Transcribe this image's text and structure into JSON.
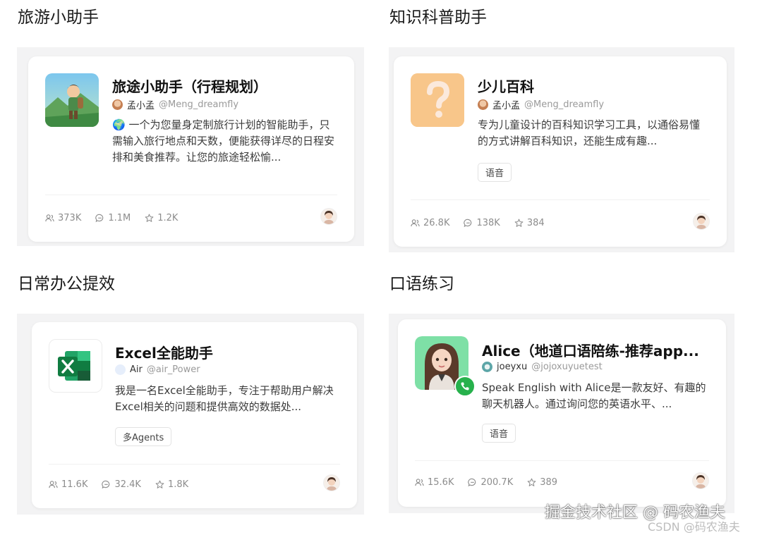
{
  "sections": [
    {
      "heading": "旅游小助手",
      "card": {
        "title": "旅途小助手（行程规划）",
        "author": "孟小孟",
        "handle": "@Meng_dreamfly",
        "description": "🌍 一个为您量身定制旅行计划的智能助手，只需输入旅行地点和天数，便能获得详尽的日程安排和美食推荐。让您的旅途轻松愉...",
        "tag": "",
        "users": "373K",
        "chats": "1.1M",
        "stars": "1.2K"
      }
    },
    {
      "heading": "知识科普助手",
      "card": {
        "title": "少儿百科",
        "author": "孟小孟",
        "handle": "@Meng_dreamfly",
        "description": "专为儿童设计的百科知识学习工具，以通俗易懂的方式讲解百科知识，还能生成有趣...",
        "tag": "语音",
        "users": "26.8K",
        "chats": "138K",
        "stars": "384"
      }
    },
    {
      "heading": "日常办公提效",
      "card": {
        "title": "Excel全能助手",
        "author": "Air",
        "handle": "@air_Power",
        "description": "我是一名Excel全能助手，专注于帮助用户解决Excel相关的问题和提供高效的数据处...",
        "tag": "多Agents",
        "users": "11.6K",
        "chats": "32.4K",
        "stars": "1.8K"
      }
    },
    {
      "heading": "口语练习",
      "card": {
        "title": "Alice（地道口语陪练-推荐app...",
        "author": "joeyxu",
        "handle": "@jojoxuyuetest",
        "description": "Speak English with Alice是一款友好、有趣的聊天机器人。通过询问您的英语水平、...",
        "tag": "语音",
        "users": "15.6K",
        "chats": "200.7K",
        "stars": "389"
      }
    }
  ],
  "icons": {
    "users": "users-icon",
    "chats": "chat-bubble-icon",
    "stars": "star-icon",
    "excel": "excel-logo-icon",
    "question": "question-mark-icon",
    "phone": "phone-icon"
  },
  "watermark": {
    "primary": "掘金技术社区 @ 码农渔夫",
    "secondary": "CSDN @码农渔夫"
  }
}
